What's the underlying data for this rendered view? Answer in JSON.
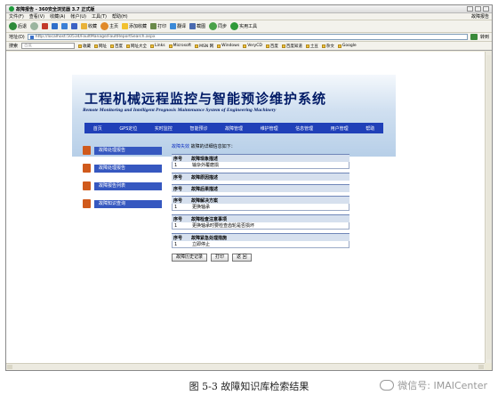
{
  "window": {
    "title": "故障报告 - 360安全浏览器 3.7 正式版",
    "right_link": "故障报告",
    "colors": {
      "brand_nav": "#2040b8",
      "sidebar_button": "#3658c0",
      "sidebar_icon": "#d05a1c",
      "title_text": "#001a66"
    }
  },
  "menubar": [
    "文件(F)",
    "查看(V)",
    "收藏(A)",
    "帐户(U)",
    "工具(T)",
    "帮助(H)"
  ],
  "toolbar": [
    {
      "label": "后退",
      "icon": "back-arrow-icon"
    },
    {
      "label": "",
      "icon": "forward-arrow-icon"
    },
    {
      "label": "",
      "icon": "stop-icon"
    },
    {
      "label": "",
      "icon": "refresh-icon"
    },
    {
      "label": "",
      "icon": "home-icon"
    },
    {
      "label": "",
      "icon": "undo-icon"
    },
    {
      "label": "收藏",
      "icon": "favorites-icon"
    },
    {
      "label": "主页",
      "icon": "homepage-icon"
    },
    {
      "label": "添加收藏",
      "icon": "star-icon"
    },
    {
      "label": "打印",
      "icon": "print-icon"
    },
    {
      "label": "翻译",
      "icon": "translate-icon"
    },
    {
      "label": "截图",
      "icon": "screenshot-icon"
    },
    {
      "label": "同步",
      "icon": "sync-icon"
    },
    {
      "label": "实用工具",
      "icon": "tools-icon"
    }
  ],
  "address": {
    "label": "地址(D)",
    "url": "http://localhost:50534/FaultManage/FaultReportSearch.aspx",
    "go_label": "转到"
  },
  "favorites": {
    "search_label": "搜索",
    "search_placeholder": "百度",
    "items": [
      "搜索",
      "收藏",
      "网址",
      "百度",
      "网址大全",
      "Links",
      "Microsoft",
      "MSN 网",
      "Windows",
      "VeryCD",
      "百度",
      "百度知道",
      "土豆",
      "杂文",
      "Google"
    ]
  },
  "page": {
    "title_cn": "工程机械远程监控与智能预诊维护系统",
    "title_en": "Remote Monitoring and Intelligent Prognosis Maintenance System of Engineering Machinery",
    "nav": [
      "首页",
      "GPS定位",
      "实时监控",
      "智能预诊",
      "故障管理",
      "维护管理",
      "信息管理",
      "用户管理",
      "帮助"
    ],
    "sidebar": [
      "故障处理报告",
      "故障处理报告",
      "故障报告列表",
      "故障知识查询"
    ],
    "breadcrumb": {
      "link": "故障失效",
      "text": "故障的详细信息如下："
    },
    "sections": [
      {
        "header": "故障现象描述",
        "rows": [
          {
            "no": "1",
            "text": "输杂外覆磨损"
          }
        ]
      },
      {
        "header": "故障原因描述",
        "rows": []
      },
      {
        "header": "故障后果描述",
        "rows": []
      },
      {
        "header": "故障解决方案",
        "rows": [
          {
            "no": "1",
            "text": "更换轴承"
          }
        ]
      },
      {
        "header": "故障检查注意事项",
        "rows": [
          {
            "no": "1",
            "text": "更换轴承时要检查齿轮是否损坏"
          }
        ]
      },
      {
        "header": "故障紧急处理措施",
        "rows": [
          {
            "no": "1",
            "text": "立即停止"
          }
        ]
      }
    ],
    "col_no": "序号",
    "buttons": [
      "故障历史记录",
      "打印",
      "返 回"
    ]
  },
  "caption": "图 5-3  故障知识库检索结果",
  "watermark": "微信号: IMAICenter"
}
